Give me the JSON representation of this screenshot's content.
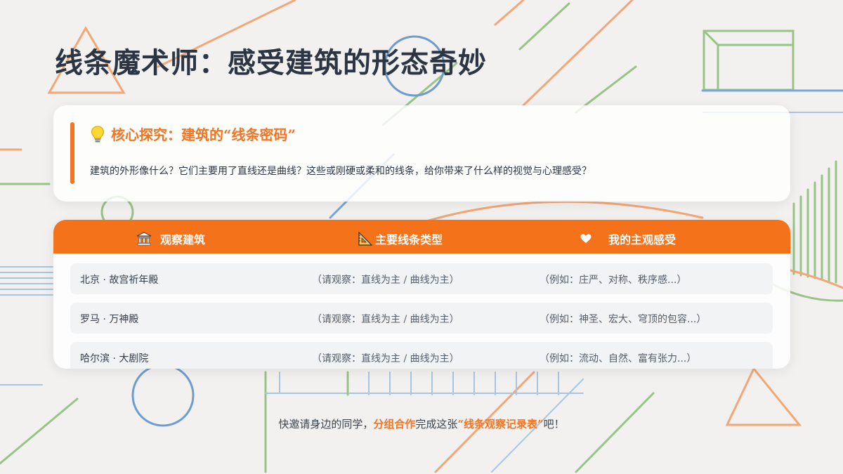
{
  "title": "线条魔术师：感受建筑的形态奇妙",
  "info": {
    "heading": "核心探究：建筑的“线条密码”",
    "description": "建筑的外形像什么？它们主要用了直线还是曲线？这些或刚硬或柔和的线条，给你带来了什么样的视觉与心理感受？",
    "icon": "lightbulb-icon"
  },
  "table": {
    "headers": [
      {
        "label": "观察建筑",
        "icon": "landmark-icon"
      },
      {
        "label": "主要线条类型",
        "icon": "triangle-ruler-icon"
      },
      {
        "label": "我的主观感受",
        "icon": "heart-icon"
      }
    ],
    "rows": [
      {
        "building": "北京 · 故宫祈年殿",
        "line_type": "（请观察：直线为主 / 曲线为主）",
        "feeling": "（例如：庄严、对称、秩序感...）"
      },
      {
        "building": "罗马 · 万神殿",
        "line_type": "（请观察：直线为主 / 曲线为主）",
        "feeling": "（例如：神圣、宏大、穹顶的包容...）"
      },
      {
        "building": "哈尔滨 · 大剧院",
        "line_type": "（请观察：直线为主 / 曲线为主）",
        "feeling": "（例如：流动、自然、富有张力...）"
      }
    ]
  },
  "footer": {
    "part1": "快邀请身边的同学，",
    "highlight1": "分组合作",
    "part2": "完成这张",
    "highlight2": "“线条观察记录表”",
    "part3": "吧！"
  },
  "colors": {
    "accent": "#f37521",
    "title": "#2b3544",
    "line_green": "#8fbf7a",
    "line_orange": "#f0a06a",
    "line_blue": "#6e9ccf"
  }
}
